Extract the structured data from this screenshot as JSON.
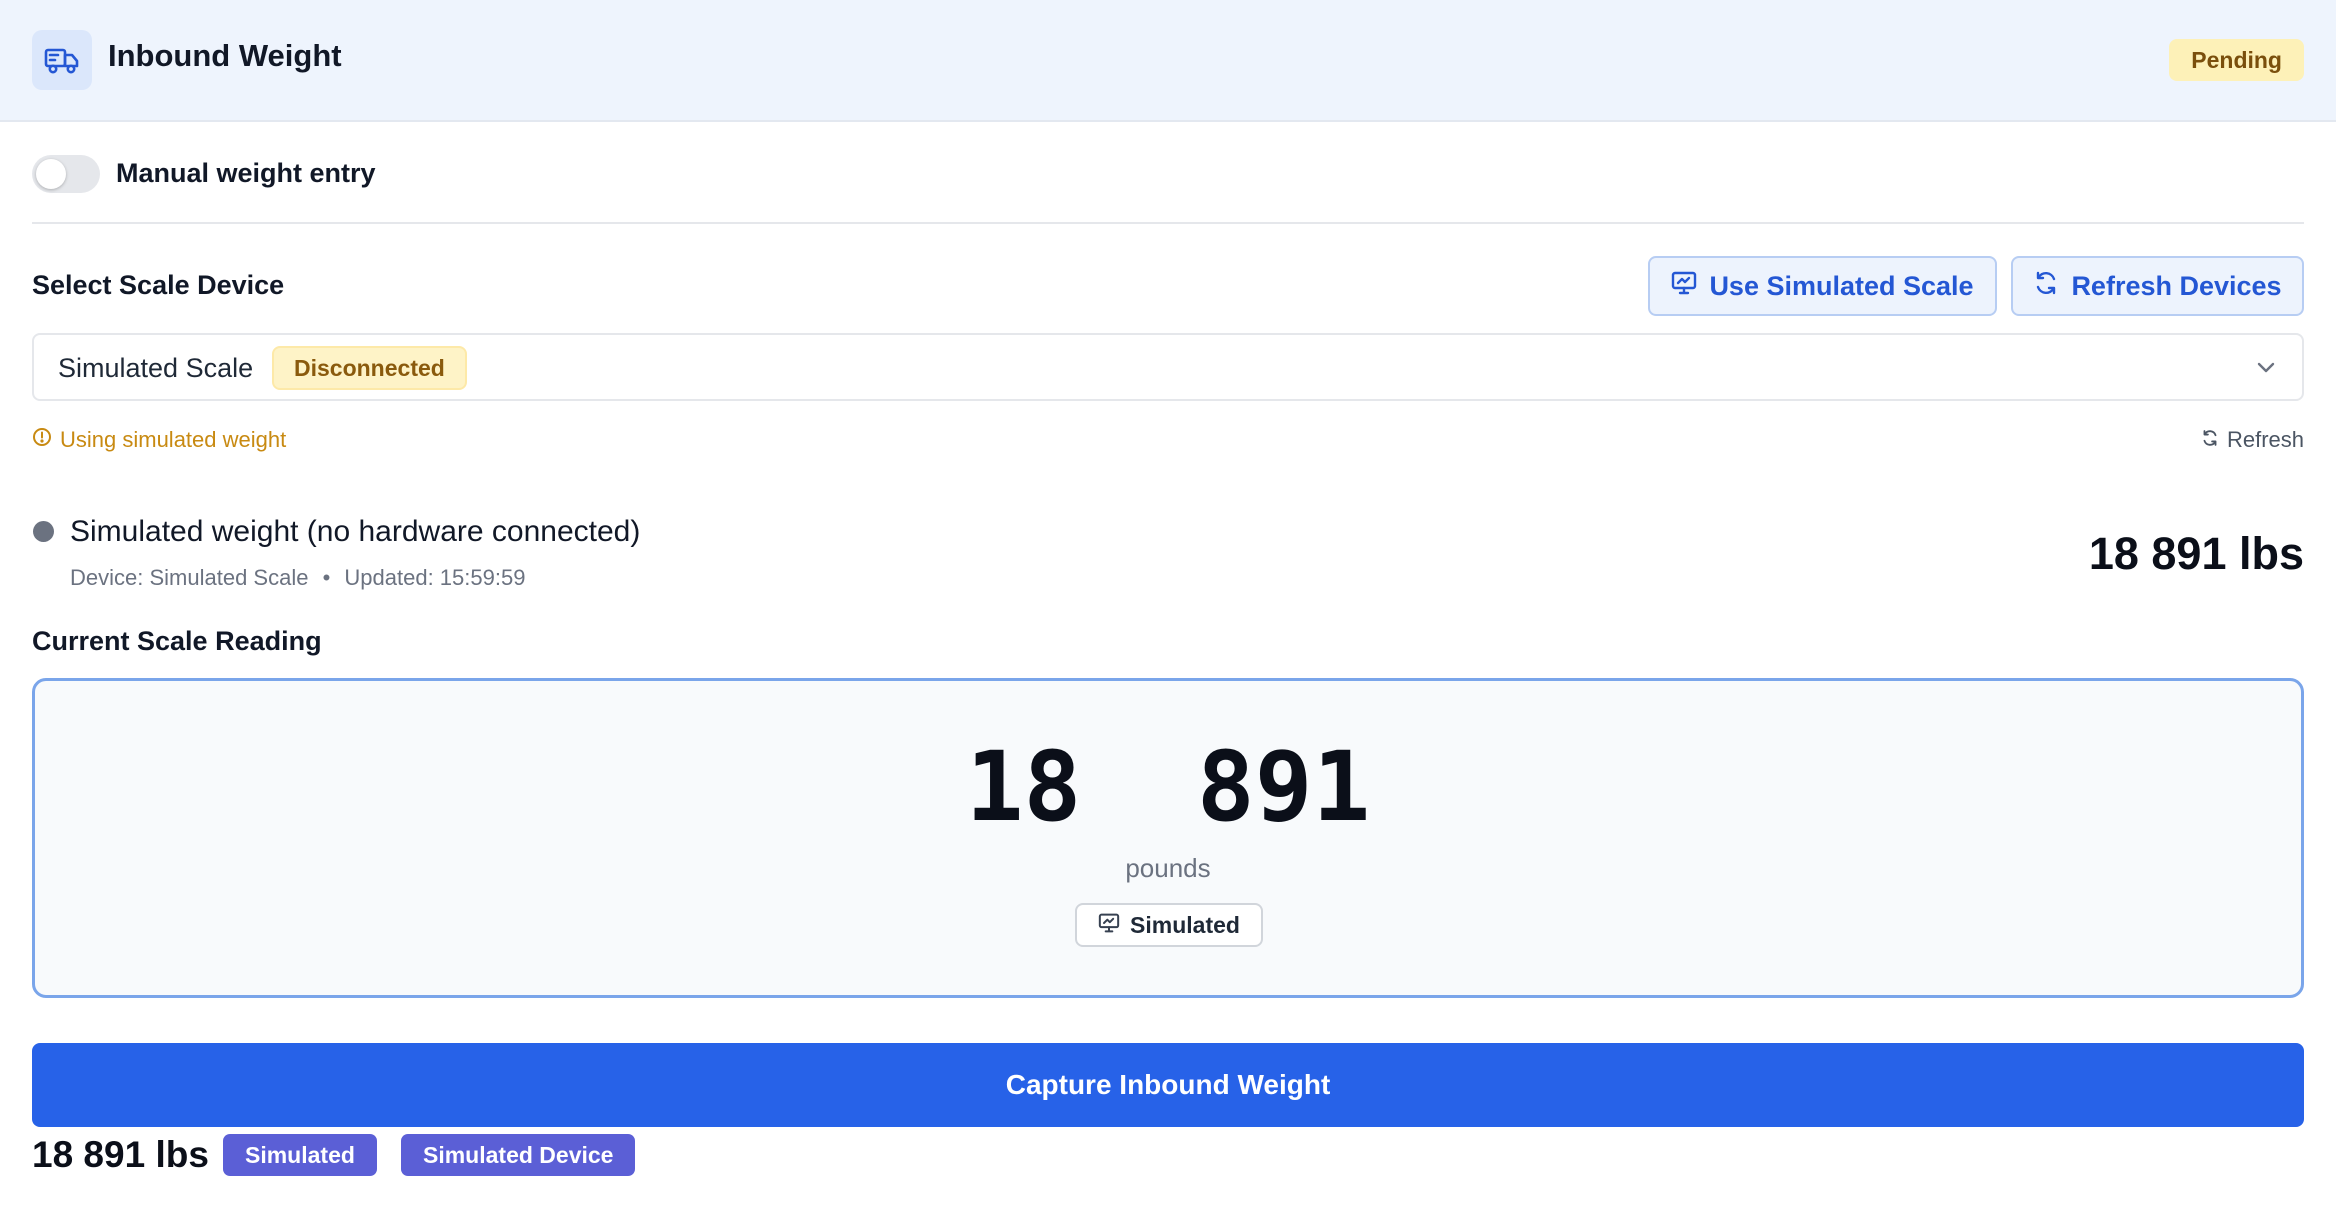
{
  "header": {
    "icon": "truck-icon",
    "title": "Inbound Weight",
    "status": "Pending"
  },
  "manual": {
    "label": "Manual weight entry",
    "enabled": false
  },
  "device": {
    "section_label": "Select Scale Device",
    "use_simulated_label": "Use Simulated Scale",
    "refresh_devices_label": "Refresh Devices",
    "selected": "Simulated Scale",
    "connection_status": "Disconnected",
    "note": "Using simulated weight",
    "refresh_label": "Refresh"
  },
  "status": {
    "title": "Simulated weight (no hardware connected)",
    "device_meta": "Device: Simulated Scale",
    "separator": "•",
    "updated_meta": "Updated: 15:59:59",
    "weight": "18 891 lbs"
  },
  "reading": {
    "section_label": "Current Scale Reading",
    "value": "18  891",
    "unit": "pounds",
    "badge": "Simulated"
  },
  "capture": {
    "label": "Capture Inbound Weight"
  },
  "summary": {
    "weight": "18 891 lbs",
    "badges": [
      "Simulated",
      "Simulated Device"
    ]
  },
  "colors": {
    "accent": "#2762e8",
    "pending": "#fdf1b8",
    "disconnected": "#fef3c7",
    "pill": "#5b5fd6"
  }
}
